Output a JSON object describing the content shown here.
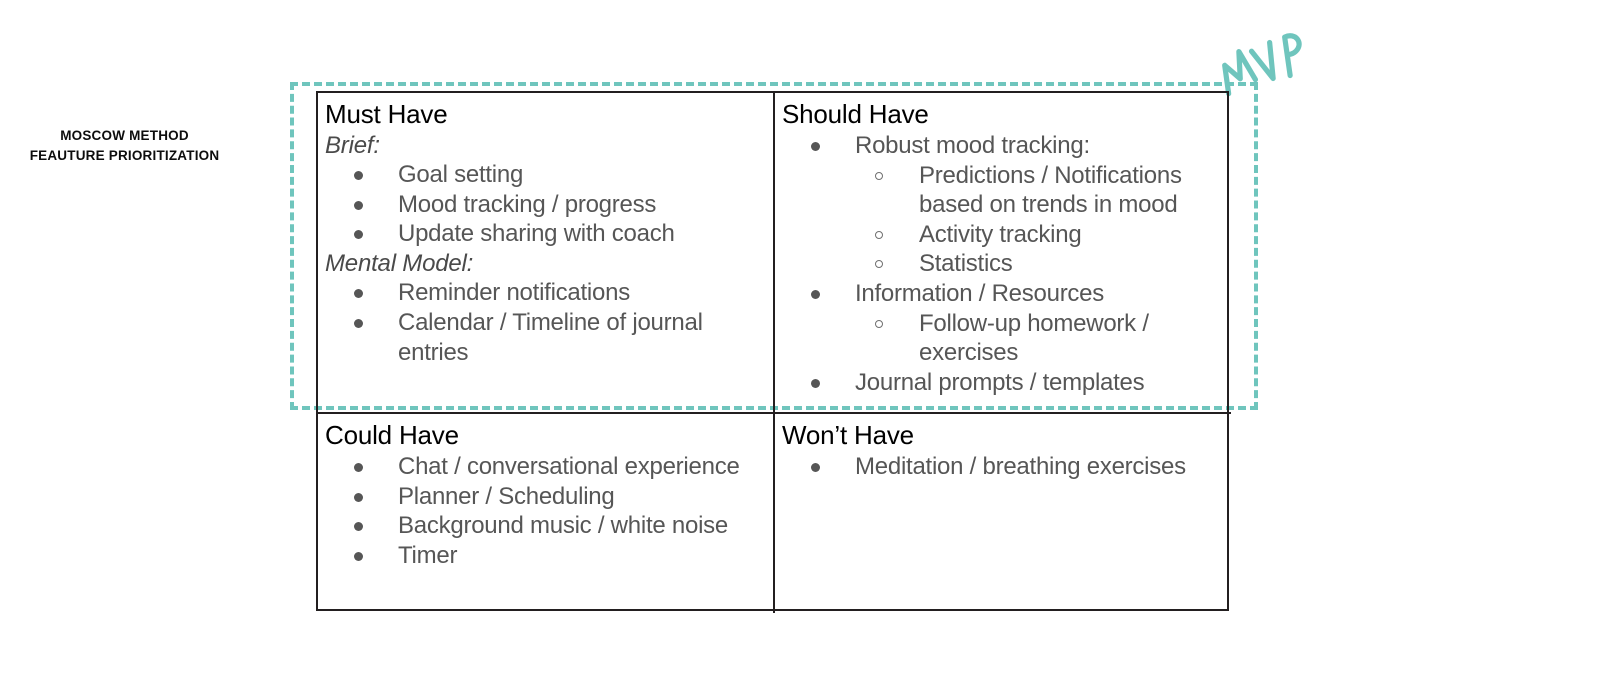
{
  "caption": {
    "line1": "MOSCOW METHOD",
    "line2": "FEAUTURE PRIORITIZATION"
  },
  "annotation": {
    "mvp_label": "MVP",
    "accent_color": "#6fc5bd"
  },
  "colors": {
    "border": "#231f20",
    "heading_text": "#000000",
    "body_text": "#565656",
    "sublabel_text": "#4a4a4a",
    "background": "#ffffff"
  },
  "matrix": {
    "quadrants": [
      {
        "title": "Must Have",
        "groups": [
          {
            "label": "Brief:",
            "items": [
              {
                "text": "Goal setting"
              },
              {
                "text": "Mood tracking / progress"
              },
              {
                "text": "Update sharing with coach"
              }
            ]
          },
          {
            "label": "Mental Model:",
            "items": [
              {
                "text": "Reminder notifications"
              },
              {
                "text": "Calendar / Timeline of journal entries"
              }
            ]
          }
        ]
      },
      {
        "title": "Should Have",
        "items": [
          {
            "text": "Robust mood tracking:",
            "children": [
              {
                "text": "Predictions / Notifications based on trends in mood"
              },
              {
                "text": "Activity tracking"
              },
              {
                "text": "Statistics"
              }
            ]
          },
          {
            "text": "Information / Resources",
            "children": [
              {
                "text": "Follow-up homework / exercises"
              }
            ]
          },
          {
            "text": "Journal prompts / templates"
          }
        ]
      },
      {
        "title": "Could Have",
        "items": [
          {
            "text": "Chat / conversational experience"
          },
          {
            "text": "Planner / Scheduling"
          },
          {
            "text": "Background music / white noise"
          },
          {
            "text": "Timer"
          }
        ]
      },
      {
        "title": "Won’t Have",
        "items": [
          {
            "text": "Meditation / breathing exercises"
          }
        ]
      }
    ]
  }
}
